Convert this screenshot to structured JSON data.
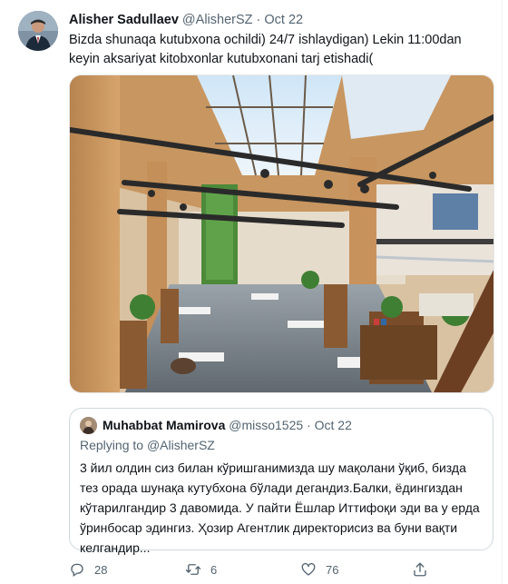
{
  "tweet": {
    "author_name": "Alisher Sadullaev",
    "author_handle": "@AlisherSZ",
    "separator": "·",
    "date": "Oct 22",
    "text": "Bizda shunaqa kutubxona ochildi) 24/7 ishlaydigan) Lekin 11:00dan keyin aksariyat kitobxonlar kutubxonani tarj etishadi("
  },
  "quote": {
    "author_name": "Muhabbat Mamirova",
    "author_handle": "@misso1525",
    "separator": "·",
    "date": "Oct 22",
    "replying_prefix": "Replying to ",
    "replying_handle": "@AlisherSZ",
    "text": "3 йил олдин сиз билан кўришганимизда шу мақолани ўқиб, бизда тез орада шунақа кутубхона бўлади дегандиз.Балки, ёдингиздан кўтарилгандир 3 давомида. У пайти Ёшлар Иттифоқи эди ва у ерда ўринбосар эдингиз. Ҳозир Агентлик директорисиз ва буни вақти келгандир..."
  },
  "actions": {
    "replies": "28",
    "retweets": "6",
    "likes": "76"
  },
  "icons": {
    "reply": "reply-icon",
    "retweet": "retweet-icon",
    "like": "heart-icon",
    "share": "share-icon"
  },
  "colors": {
    "text_primary": "#0f1419",
    "text_secondary": "#536471",
    "border": "#cfd9de"
  }
}
